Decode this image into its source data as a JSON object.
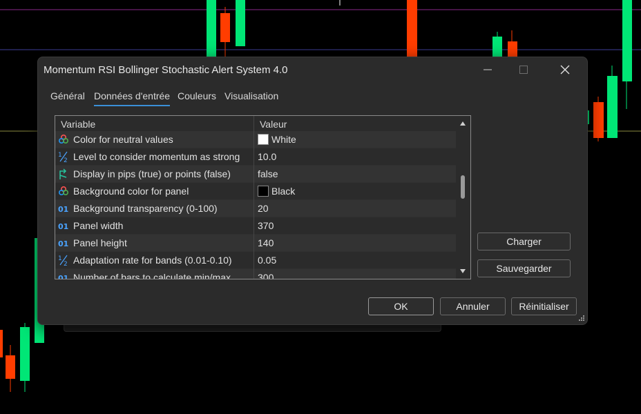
{
  "window": {
    "title": "Momentum RSI Bollinger Stochastic Alert System 4.0"
  },
  "tabs": [
    {
      "label": "Général",
      "active": false
    },
    {
      "label": "Données d'entrée",
      "active": true
    },
    {
      "label": "Couleurs",
      "active": false
    },
    {
      "label": "Visualisation",
      "active": false
    }
  ],
  "grid": {
    "col_variable": "Variable",
    "col_value": "Valeur",
    "rows": [
      {
        "icon": "color-palette-icon",
        "label": "Color for neutral values",
        "value": "White",
        "swatch": "#ffffff"
      },
      {
        "icon": "fraction-icon",
        "label": "Level to consider momentum as strong",
        "value": "10.0"
      },
      {
        "icon": "boolean-arrow-icon",
        "label": "Display in pips (true) or points (false)",
        "value": "false"
      },
      {
        "icon": "color-palette-icon",
        "label": "Background color for panel",
        "value": "Black",
        "swatch": "#000000"
      },
      {
        "icon": "integer-icon",
        "label": "Background transparency (0-100)",
        "value": "20"
      },
      {
        "icon": "integer-icon",
        "label": "Panel width",
        "value": "370"
      },
      {
        "icon": "integer-icon",
        "label": "Panel height",
        "value": "140"
      },
      {
        "icon": "fraction-icon",
        "label": "Adaptation rate for bands (0.01-0.10)",
        "value": "0.05"
      },
      {
        "icon": "integer-icon",
        "label": "Number of bars to calculate min/max",
        "value": "300"
      }
    ]
  },
  "side_buttons": {
    "load": "Charger",
    "save": "Sauvegarder"
  },
  "footer_buttons": {
    "ok": "OK",
    "cancel": "Annuler",
    "reset": "Réinitialiser"
  },
  "colors": {
    "bull_candle": "#00e676",
    "bear_candle": "#ff3d00",
    "accent": "#3a90d8"
  }
}
